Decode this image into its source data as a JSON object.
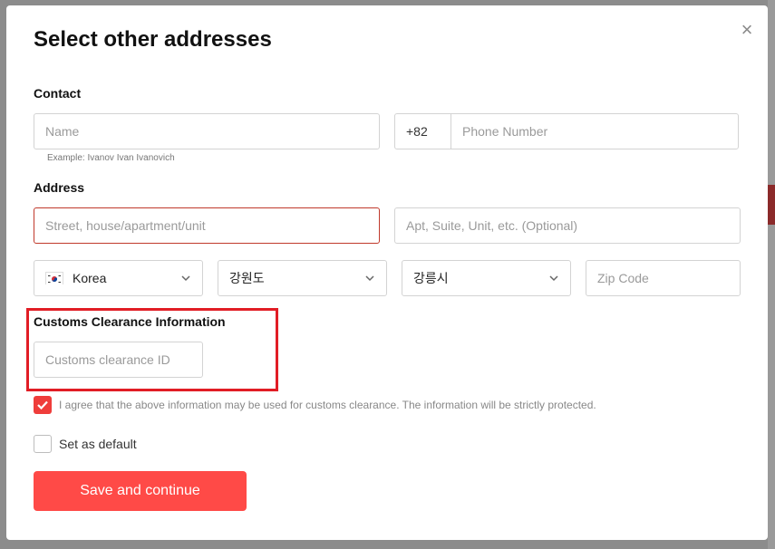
{
  "dialog": {
    "title": "Select other addresses",
    "close_glyph": "×"
  },
  "contact": {
    "section_label": "Contact",
    "name_placeholder": "Name",
    "name_hint": "Example: Ivanov Ivan Ivanovich",
    "phone_code": "+82",
    "phone_placeholder": "Phone Number"
  },
  "address": {
    "section_label": "Address",
    "street_placeholder": "Street, house/apartment/unit",
    "apt_placeholder": "Apt, Suite, Unit, etc. (Optional)",
    "country": "Korea",
    "province": "강원도",
    "city": "강릉시",
    "zip_placeholder": "Zip Code"
  },
  "customs": {
    "section_label": "Customs Clearance Information",
    "id_placeholder": "Customs clearance ID"
  },
  "agree": {
    "checked": true,
    "text": "I agree that the above information may be used for customs clearance. The information will be strictly protected."
  },
  "default_option": {
    "checked": false,
    "label": "Set as default"
  },
  "save_button": {
    "label": "Save and continue"
  },
  "colors": {
    "accent": "#ff4a47",
    "checkbox_checked": "#ef3d3b",
    "highlight": "#e11d25",
    "error_border": "#c0392b"
  }
}
